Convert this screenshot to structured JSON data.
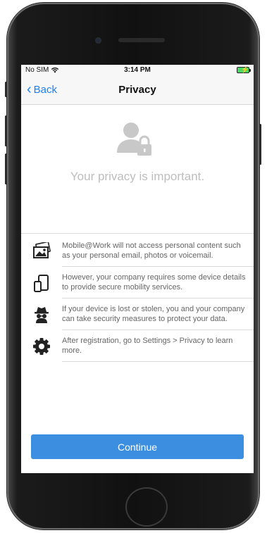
{
  "status_bar": {
    "carrier": "No SIM",
    "time": "3:14 PM"
  },
  "nav": {
    "back_label": "Back",
    "title": "Privacy"
  },
  "hero": {
    "text": "Your privacy is important."
  },
  "items": [
    {
      "icon": "photo-icon",
      "text": "Mobile@Work will not access personal content such as your personal email, photos or voicemail."
    },
    {
      "icon": "devices-icon",
      "text": "However, your company requires some device details to provide secure mobility services."
    },
    {
      "icon": "spy-icon",
      "text": "If your device is lost or stolen, you and your company can take security measures to protect your data."
    },
    {
      "icon": "gear-icon",
      "text": "After registration, go to Settings > Privacy to learn more."
    }
  ],
  "continue_label": "Continue",
  "colors": {
    "accent": "#1a82f7",
    "button": "#3c8fe0",
    "battery": "#4cd964"
  }
}
